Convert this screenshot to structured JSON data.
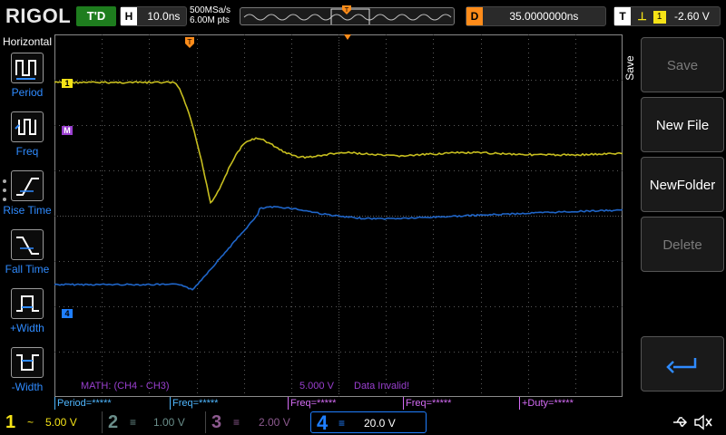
{
  "brand": "RIGOL",
  "trigger_status": "T'D",
  "horizontal": {
    "label": "H",
    "timebase": "10.0ns"
  },
  "acquisition": {
    "sample_rate": "500MSa/s",
    "memory": "6.00M pts"
  },
  "delay": {
    "label": "D",
    "value": "35.0000000ns"
  },
  "trigger": {
    "label": "T",
    "level": "-2.60 V"
  },
  "left_menu": {
    "title": "Horizontal",
    "items": [
      {
        "label": "Period",
        "icon": "period-pulse-icon"
      },
      {
        "label": "Freq",
        "icon": "frequency-pulse-icon"
      },
      {
        "label": "Rise Time",
        "icon": "rise-time-icon"
      },
      {
        "label": "Fall Time",
        "icon": "fall-time-icon"
      },
      {
        "label": "+Width",
        "icon": "positive-width-icon"
      },
      {
        "label": "-Width",
        "icon": "negative-width-icon"
      }
    ]
  },
  "right_menu": {
    "side_label": "Save",
    "buttons": [
      {
        "label": "Save",
        "enabled": false
      },
      {
        "label": "New File",
        "enabled": true
      },
      {
        "label": "NewFolder",
        "enabled": true
      },
      {
        "label": "Delete",
        "enabled": false
      }
    ],
    "back_icon": "return-arrow-icon"
  },
  "screen": {
    "math_label": "MATH: (CH4 - CH3)",
    "math_scale": "5.000 V",
    "math_status": "Data Invalid!",
    "markers": {
      "ch1": "1",
      "math": "M",
      "ch4": "4",
      "trigger_top": "T"
    }
  },
  "measurements": [
    {
      "label": "Period=*****"
    },
    {
      "label": "Freq=*****"
    },
    {
      "label": "Freq=*****"
    },
    {
      "label": "Freq=*****"
    },
    {
      "label": "+Duty=*****"
    }
  ],
  "channels": [
    {
      "num": "1",
      "coupling": "~",
      "scale": "5.00 V",
      "color": "#f5e317",
      "active": true
    },
    {
      "num": "2",
      "coupling": "",
      "scale": "1.00 V",
      "color": "#6a8e8a",
      "active": false
    },
    {
      "num": "3",
      "coupling": "",
      "scale": "2.00 V",
      "color": "#8d5a8f",
      "active": false
    },
    {
      "num": "4",
      "coupling": "",
      "scale": "20.0 V",
      "color": "#1f7fff",
      "active": true
    }
  ],
  "colors": {
    "ch1": "#c7be1f",
    "ch4": "#1f65c8",
    "math": "#9a3fd0",
    "grid": "#5a5a5a",
    "accent_orange": "#ff8c1a"
  },
  "icons": [
    "usb-icon",
    "speaker-muted-icon"
  ]
}
